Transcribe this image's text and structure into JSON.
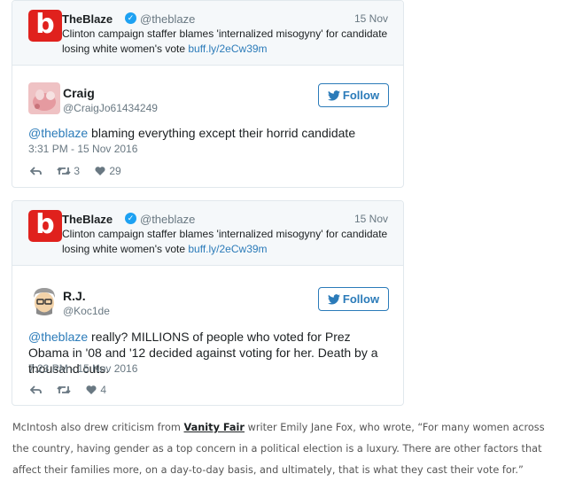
{
  "tweets": [
    {
      "quoted": {
        "logo_letter": "b",
        "name": "TheBlaze",
        "handle": "@theblaze",
        "date": "15 Nov",
        "text": "Clinton campaign staffer blames 'internalized misogyny' for candidate losing white women's vote",
        "link": "buff.ly/2eCw39m"
      },
      "author": {
        "name": "Craig",
        "handle": "@CraigJo61434249"
      },
      "follow_label": "Follow",
      "mention": "@theblaze",
      "text": " blaming everything except their horrid candidate",
      "time": "3:31 PM - 15 Nov 2016",
      "retweets": "3",
      "likes": "29"
    },
    {
      "quoted": {
        "logo_letter": "b",
        "name": "TheBlaze",
        "handle": "@theblaze",
        "date": "15 Nov",
        "text": "Clinton campaign staffer blames 'internalized misogyny' for candidate losing white women's vote",
        "link": "buff.ly/2eCw39m"
      },
      "author": {
        "name": "R.J.",
        "handle": "@Koc1de"
      },
      "follow_label": "Follow",
      "mention": "@theblaze",
      "text": " really? MILLIONS of people who voted for Prez Obama in '08 and '12 decided against voting for her. Death by a thousand cuts.",
      "time": "7:23 PM - 15 Nov 2016",
      "retweets": "",
      "likes": "4"
    }
  ],
  "article": {
    "before": "McIntosh also drew criticism from ",
    "magazine": "Vanity Fair",
    "after": " writer Emily Jane Fox, who wrote, “For many women across the country, having gender as a top concern in a political election is a luxury. There are other factors that affect their families more, on a day-to-day basis, and ultimately, that is what they cast their vote for.”"
  },
  "colors": {
    "brand_red": "#e0211d",
    "twitter_blue": "#1da1f2",
    "link_blue": "#2b7bb9",
    "like_heart": "#697882"
  },
  "icons": [
    "reply-icon",
    "retweet-icon",
    "heart-icon",
    "twitter-bird-icon",
    "verified-icon"
  ]
}
